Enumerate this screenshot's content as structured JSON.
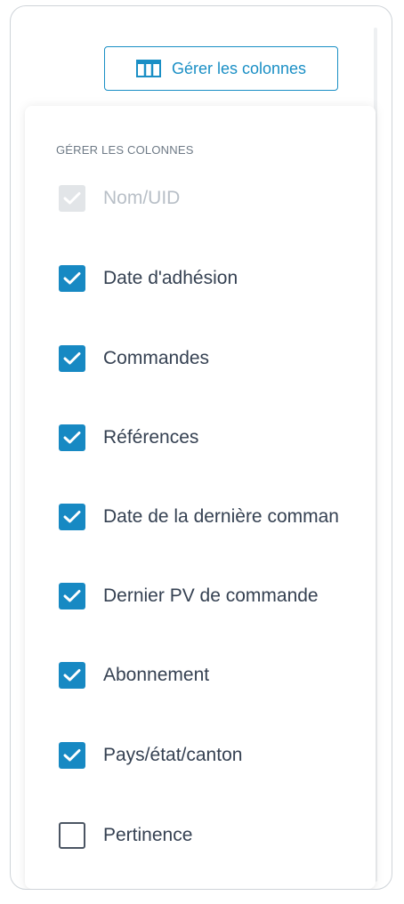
{
  "toolbar": {
    "manage_columns_label": "Gérer les colonnes",
    "icon": "columns-icon",
    "accent": "#1a8fc5"
  },
  "panel": {
    "title": "GÉRER LES COLONNES",
    "items": [
      {
        "label": "Nom/UID",
        "checked": true,
        "disabled": true
      },
      {
        "label": "Date d'adhésion",
        "checked": true,
        "disabled": false
      },
      {
        "label": "Commandes",
        "checked": true,
        "disabled": false
      },
      {
        "label": "Références",
        "checked": true,
        "disabled": false
      },
      {
        "label": "Date de la dernière comman",
        "checked": true,
        "disabled": false
      },
      {
        "label": "Dernier PV de commande",
        "checked": true,
        "disabled": false
      },
      {
        "label": "Abonnement",
        "checked": true,
        "disabled": false
      },
      {
        "label": "Pays/état/canton",
        "checked": true,
        "disabled": false
      },
      {
        "label": "Pertinence",
        "checked": false,
        "disabled": false
      }
    ]
  },
  "colors": {
    "checkbox_checked": "#1789c3",
    "checkbox_disabled": "#e2e5e8",
    "text": "#354152"
  }
}
